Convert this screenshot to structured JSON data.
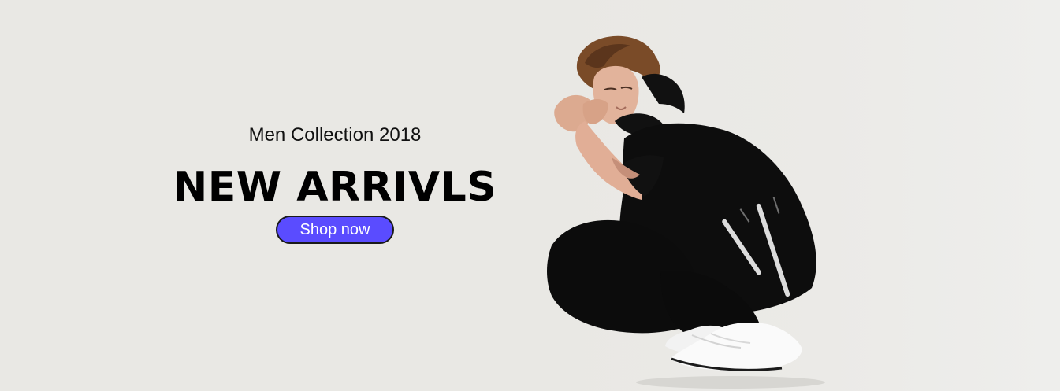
{
  "hero": {
    "subtitle": "Men Collection 2018",
    "headline": "NEW ARRIVLS",
    "cta_label": "Shop now",
    "accent_color": "#5a4cff",
    "background_color": "#e9e8e4"
  }
}
